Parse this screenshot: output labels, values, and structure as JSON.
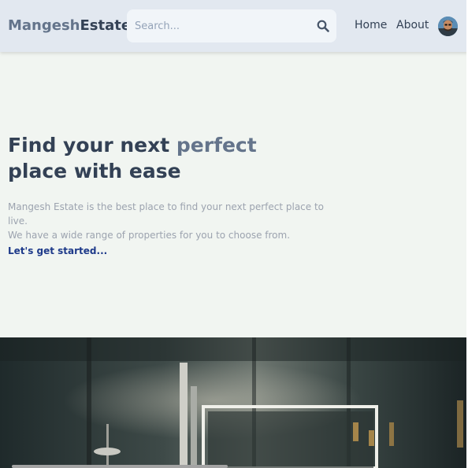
{
  "header": {
    "logo_part1": "Mangesh",
    "logo_part2": "Estate",
    "search_placeholder": "Search...",
    "search_icon": "magnifier-icon",
    "nav": {
      "home": "Home",
      "about": "About"
    },
    "avatar_icon": "user-avatar"
  },
  "hero": {
    "title_part1": "Find your next ",
    "title_accent": "perfect",
    "title_part2": "place with ease",
    "desc_line1": "Mangesh Estate is the best place to find your next perfect place to live.",
    "desc_line2": "We have a wide range of properties for you to choose from.",
    "cta": "Let's get started..."
  },
  "colors": {
    "header_bg": "#e2e8f0",
    "page_bg": "#f1f5f1",
    "text_dark": "#334155",
    "text_accent": "#64748b",
    "cta": "#1e3a8a"
  }
}
